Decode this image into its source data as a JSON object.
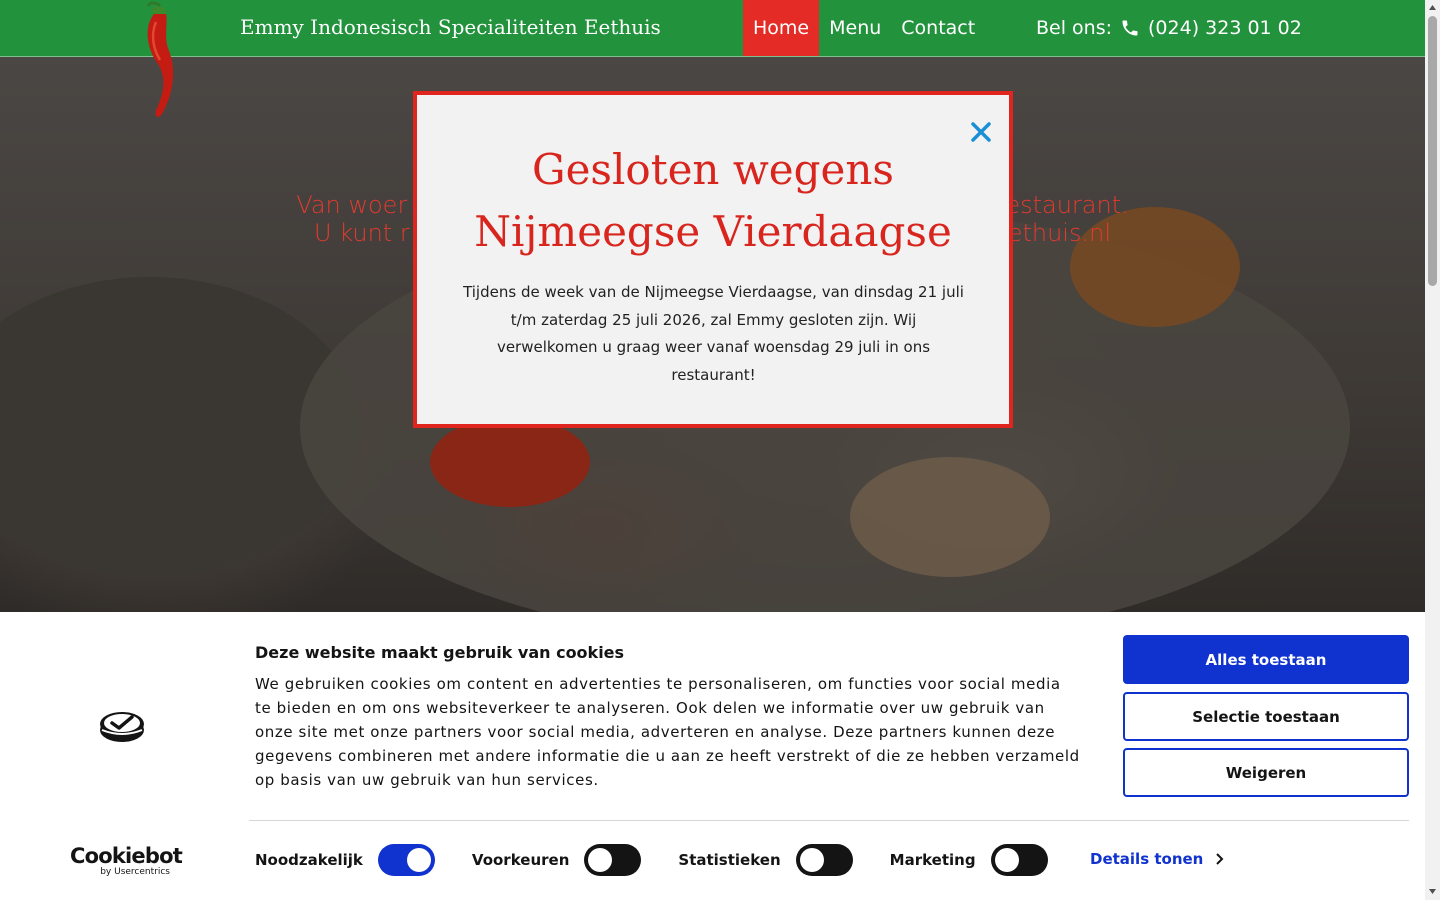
{
  "header": {
    "site_title": "Emmy Indonesisch Specialiteiten Eethuis",
    "nav": [
      {
        "label": "Home",
        "active": true
      },
      {
        "label": "Menu",
        "active": false
      },
      {
        "label": "Contact",
        "active": false
      }
    ],
    "phone_prefix": "Bel ons:",
    "phone_number": "(024) 323 01 02",
    "colors": {
      "bar": "#22923d",
      "active": "#e52b25"
    }
  },
  "hero": {
    "line1_left": "Van woer",
    "line1_right": "estaurant.",
    "line2_left": "U kunt r",
    "line2_right": "ethuis.nl"
  },
  "modal": {
    "title_line1": "Gesloten wegens",
    "title_line2": "Nijmeegse Vierdaagse",
    "body": "Tijdens de week van de Nijmeegse Vierdaagse, van dinsdag 21 juli t/m zaterdag 25 juli 2026, zal Emmy gesloten zijn. Wij verwelkomen u graag weer vanaf woensdag 29 juli in ons restaurant!",
    "close_icon": "close-icon",
    "colors": {
      "border": "#e0251f",
      "title": "#d8261f",
      "close": "#1a8fd6"
    }
  },
  "cookie": {
    "title": "Deze website maakt gebruik van cookies",
    "text": "We gebruiken cookies om content en advertenties te personaliseren, om functies voor social media te bieden en om ons websiteverkeer te analyseren. Ook delen we informatie over uw gebruik van onze site met onze partners voor social media, adverteren en analyse. Deze partners kunnen deze gegevens combineren met andere informatie die u aan ze heeft verstrekt of die ze hebben verzameld op basis van uw gebruik van hun services.",
    "buttons": {
      "allow_all": "Alles toestaan",
      "allow_selection": "Selectie toestaan",
      "deny": "Weigeren"
    },
    "brand_name": "Cookiebot",
    "brand_by": "by Usercentrics",
    "toggles": [
      {
        "label": "Noodzakelijk",
        "on": true
      },
      {
        "label": "Voorkeuren",
        "on": false
      },
      {
        "label": "Statistieken",
        "on": false
      },
      {
        "label": "Marketing",
        "on": false
      }
    ],
    "details_link": "Details tonen",
    "colors": {
      "accent": "#1032cf"
    }
  }
}
